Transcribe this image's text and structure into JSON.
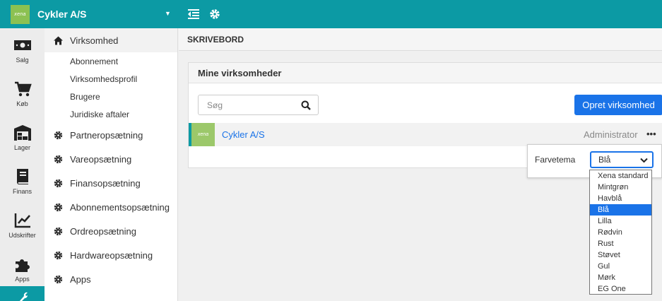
{
  "header": {
    "logo_text": "xena",
    "company": "Cykler A/S"
  },
  "rail": {
    "items": [
      {
        "label": "Salg",
        "icon": "money-icon"
      },
      {
        "label": "Køb",
        "icon": "cart-icon"
      },
      {
        "label": "Lager",
        "icon": "warehouse-icon"
      },
      {
        "label": "Finans",
        "icon": "book-icon"
      },
      {
        "label": "Udskrifter",
        "icon": "chart-line-icon"
      },
      {
        "label": "Apps",
        "icon": "puzzle-icon"
      }
    ]
  },
  "submenu": {
    "active": "Virksomhed",
    "sub_items": [
      "Abonnement",
      "Virksomhedsprofil",
      "Brugere",
      "Juridiske aftaler"
    ],
    "sections": [
      "Partneropsætning",
      "Vareopsætning",
      "Finansopsætning",
      "Abonnementsopsætning",
      "Ordreopsætning",
      "Hardwareopsætning",
      "Apps"
    ]
  },
  "main": {
    "page_title": "SKRIVEBORD",
    "panel_title": "Mine virksomheder",
    "search_placeholder": "Søg",
    "create_button": "Opret virksomhed",
    "company_row": {
      "logo_text": "xena",
      "name": "Cykler A/S",
      "role": "Administrator",
      "more": "•••"
    }
  },
  "popover": {
    "label": "Farvetema",
    "selected": "Blå",
    "options": [
      "Xena standard",
      "Mintgrøn",
      "Havblå",
      "Blå",
      "Lilla",
      "Rødvin",
      "Rust",
      "Støvet",
      "Gul",
      "Mørk",
      "EG One"
    ]
  },
  "colors": {
    "teal": "#0c9aa4",
    "blue": "#1a73e8",
    "logo_green": "#8cc152"
  }
}
